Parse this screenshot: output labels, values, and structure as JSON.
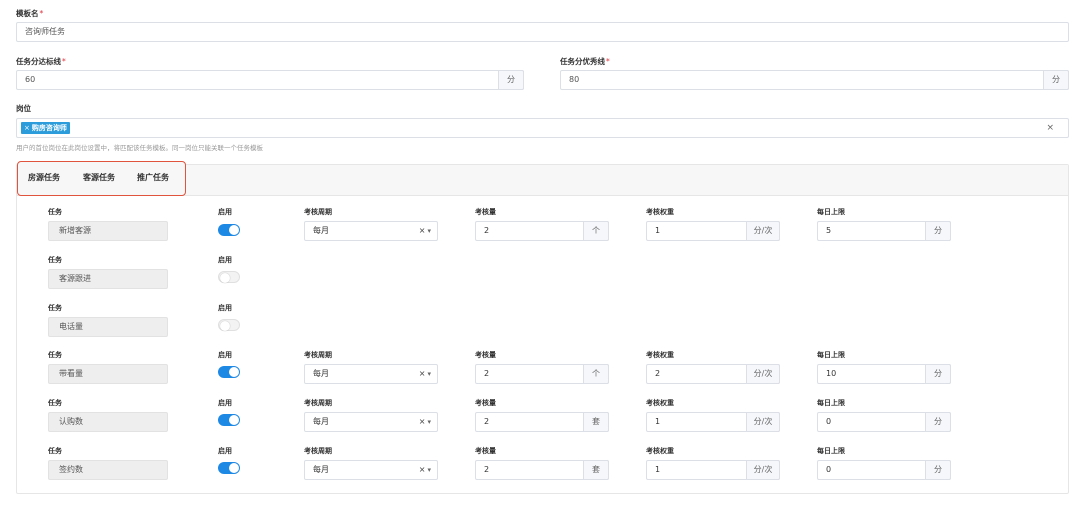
{
  "template": {
    "label": "模板名",
    "required_mark": "*",
    "value": "咨询师任务"
  },
  "pass_line": {
    "label": "任务分达标线",
    "required_mark": "*",
    "value": "60",
    "unit": "分"
  },
  "excellent_line": {
    "label": "任务分优秀线",
    "required_mark": "*",
    "value": "80",
    "unit": "分"
  },
  "position": {
    "label": "岗位",
    "tag": "购房咨询师",
    "tag_remove": "×",
    "clear": "×",
    "hint": "用户的首位岗位在此岗位设置中，将匹配该任务模板。同一岗位只能关联一个任务模板"
  },
  "tabs": [
    "房源任务",
    "客源任务",
    "推广任务"
  ],
  "columns": {
    "task": "任务",
    "enabled": "启用",
    "period": "考核周期",
    "amount": "考核量",
    "weight": "考核权重",
    "daily_limit": "每日上限"
  },
  "select_controls": {
    "clear": "×",
    "arrow": "▾"
  },
  "rows": [
    {
      "task": "新增客源",
      "enabled": true,
      "period": "每月",
      "amount": "2",
      "amount_unit": "个",
      "weight": "1",
      "weight_unit": "分/次",
      "limit": "5",
      "limit_unit": "分"
    },
    {
      "task": "客源跟进",
      "enabled": false
    },
    {
      "task": "电话量",
      "enabled": false
    },
    {
      "task": "带看量",
      "enabled": true,
      "period": "每月",
      "amount": "2",
      "amount_unit": "个",
      "weight": "2",
      "weight_unit": "分/次",
      "limit": "10",
      "limit_unit": "分"
    },
    {
      "task": "认购数",
      "enabled": true,
      "period": "每月",
      "amount": "2",
      "amount_unit": "套",
      "weight": "1",
      "weight_unit": "分/次",
      "limit": "0",
      "limit_unit": "分"
    },
    {
      "task": "签约数",
      "enabled": true,
      "period": "每月",
      "amount": "2",
      "amount_unit": "套",
      "weight": "1",
      "weight_unit": "分/次",
      "limit": "0",
      "limit_unit": "分"
    }
  ],
  "colors": {
    "accent": "#1e88e5",
    "tag": "#2d9cdb",
    "highlight": "#e0533d",
    "required": "#e0303a"
  }
}
